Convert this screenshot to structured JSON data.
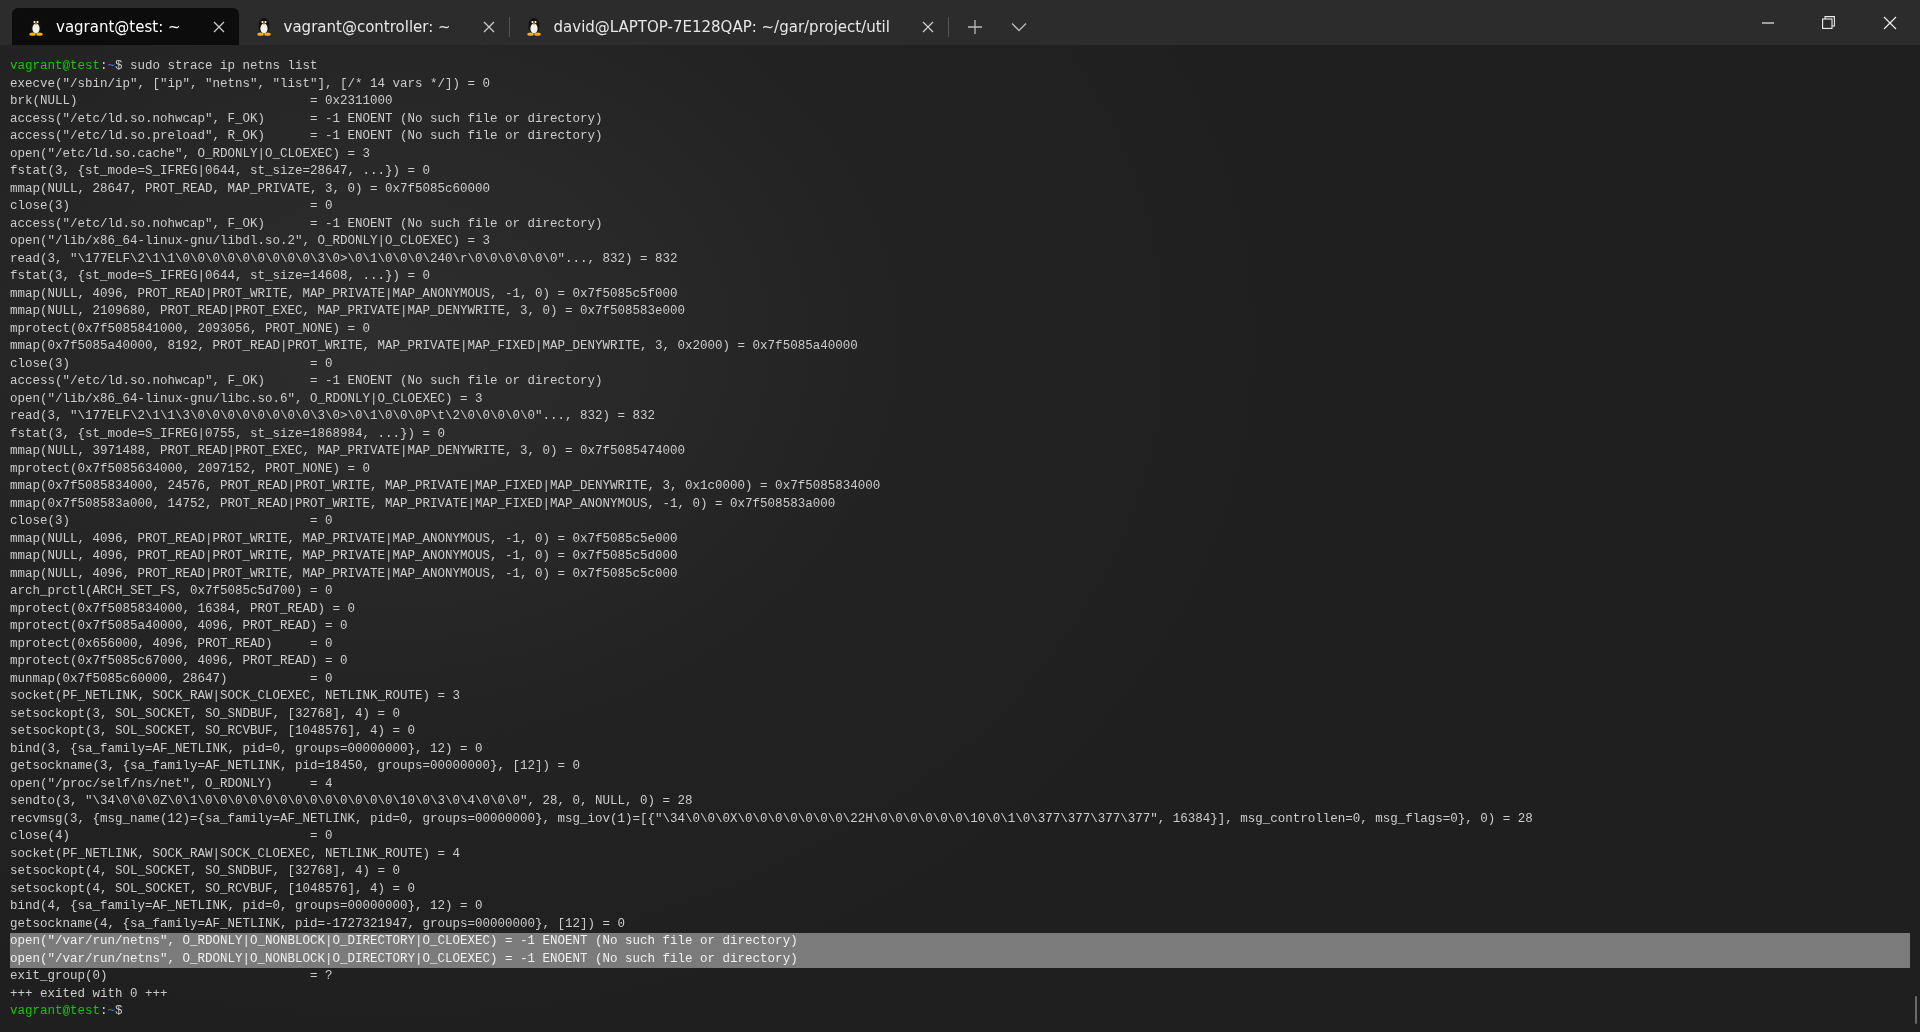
{
  "tabs": [
    {
      "title": "vagrant@test: ~",
      "selected": true
    },
    {
      "title": "vagrant@controller: ~",
      "selected": false
    },
    {
      "title": "david@LAPTOP-7E128QAP: ~/gar/project/util",
      "selected": false
    }
  ],
  "lines": [
    {
      "kind": "prompt",
      "user_host": "vagrant@test",
      "separator": ":",
      "path": "~",
      "symbol": "$",
      "command": " sudo strace ip netns list"
    },
    {
      "kind": "output",
      "text": "execve(\"/sbin/ip\", [\"ip\", \"netns\", \"list\"], [/* 14 vars */]) = 0",
      "selected": false
    },
    {
      "kind": "output",
      "text": "brk(NULL)                               = 0x2311000",
      "selected": false
    },
    {
      "kind": "output",
      "text": "access(\"/etc/ld.so.nohwcap\", F_OK)      = -1 ENOENT (No such file or directory)",
      "selected": false
    },
    {
      "kind": "output",
      "text": "access(\"/etc/ld.so.preload\", R_OK)      = -1 ENOENT (No such file or directory)",
      "selected": false
    },
    {
      "kind": "output",
      "text": "open(\"/etc/ld.so.cache\", O_RDONLY|O_CLOEXEC) = 3",
      "selected": false
    },
    {
      "kind": "output",
      "text": "fstat(3, {st_mode=S_IFREG|0644, st_size=28647, ...}) = 0",
      "selected": false
    },
    {
      "kind": "output",
      "text": "mmap(NULL, 28647, PROT_READ, MAP_PRIVATE, 3, 0) = 0x7f5085c60000",
      "selected": false
    },
    {
      "kind": "output",
      "text": "close(3)                                = 0",
      "selected": false
    },
    {
      "kind": "output",
      "text": "access(\"/etc/ld.so.nohwcap\", F_OK)      = -1 ENOENT (No such file or directory)",
      "selected": false
    },
    {
      "kind": "output",
      "text": "open(\"/lib/x86_64-linux-gnu/libdl.so.2\", O_RDONLY|O_CLOEXEC) = 3",
      "selected": false
    },
    {
      "kind": "output",
      "text": "read(3, \"\\177ELF\\2\\1\\1\\0\\0\\0\\0\\0\\0\\0\\0\\0\\3\\0>\\0\\1\\0\\0\\0\\240\\r\\0\\0\\0\\0\\0\\0\"..., 832) = 832",
      "selected": false
    },
    {
      "kind": "output",
      "text": "fstat(3, {st_mode=S_IFREG|0644, st_size=14608, ...}) = 0",
      "selected": false
    },
    {
      "kind": "output",
      "text": "mmap(NULL, 4096, PROT_READ|PROT_WRITE, MAP_PRIVATE|MAP_ANONYMOUS, -1, 0) = 0x7f5085c5f000",
      "selected": false
    },
    {
      "kind": "output",
      "text": "mmap(NULL, 2109680, PROT_READ|PROT_EXEC, MAP_PRIVATE|MAP_DENYWRITE, 3, 0) = 0x7f508583e000",
      "selected": false
    },
    {
      "kind": "output",
      "text": "mprotect(0x7f5085841000, 2093056, PROT_NONE) = 0",
      "selected": false
    },
    {
      "kind": "output",
      "text": "mmap(0x7f5085a40000, 8192, PROT_READ|PROT_WRITE, MAP_PRIVATE|MAP_FIXED|MAP_DENYWRITE, 3, 0x2000) = 0x7f5085a40000",
      "selected": false
    },
    {
      "kind": "output",
      "text": "close(3)                                = 0",
      "selected": false
    },
    {
      "kind": "output",
      "text": "access(\"/etc/ld.so.nohwcap\", F_OK)      = -1 ENOENT (No such file or directory)",
      "selected": false
    },
    {
      "kind": "output",
      "text": "open(\"/lib/x86_64-linux-gnu/libc.so.6\", O_RDONLY|O_CLOEXEC) = 3",
      "selected": false
    },
    {
      "kind": "output",
      "text": "read(3, \"\\177ELF\\2\\1\\1\\3\\0\\0\\0\\0\\0\\0\\0\\0\\3\\0>\\0\\1\\0\\0\\0P\\t\\2\\0\\0\\0\\0\\0\"..., 832) = 832",
      "selected": false
    },
    {
      "kind": "output",
      "text": "fstat(3, {st_mode=S_IFREG|0755, st_size=1868984, ...}) = 0",
      "selected": false
    },
    {
      "kind": "output",
      "text": "mmap(NULL, 3971488, PROT_READ|PROT_EXEC, MAP_PRIVATE|MAP_DENYWRITE, 3, 0) = 0x7f5085474000",
      "selected": false
    },
    {
      "kind": "output",
      "text": "mprotect(0x7f5085634000, 2097152, PROT_NONE) = 0",
      "selected": false
    },
    {
      "kind": "output",
      "text": "mmap(0x7f5085834000, 24576, PROT_READ|PROT_WRITE, MAP_PRIVATE|MAP_FIXED|MAP_DENYWRITE, 3, 0x1c0000) = 0x7f5085834000",
      "selected": false
    },
    {
      "kind": "output",
      "text": "mmap(0x7f508583a000, 14752, PROT_READ|PROT_WRITE, MAP_PRIVATE|MAP_FIXED|MAP_ANONYMOUS, -1, 0) = 0x7f508583a000",
      "selected": false
    },
    {
      "kind": "output",
      "text": "close(3)                                = 0",
      "selected": false
    },
    {
      "kind": "output",
      "text": "mmap(NULL, 4096, PROT_READ|PROT_WRITE, MAP_PRIVATE|MAP_ANONYMOUS, -1, 0) = 0x7f5085c5e000",
      "selected": false
    },
    {
      "kind": "output",
      "text": "mmap(NULL, 4096, PROT_READ|PROT_WRITE, MAP_PRIVATE|MAP_ANONYMOUS, -1, 0) = 0x7f5085c5d000",
      "selected": false
    },
    {
      "kind": "output",
      "text": "mmap(NULL, 4096, PROT_READ|PROT_WRITE, MAP_PRIVATE|MAP_ANONYMOUS, -1, 0) = 0x7f5085c5c000",
      "selected": false
    },
    {
      "kind": "output",
      "text": "arch_prctl(ARCH_SET_FS, 0x7f5085c5d700) = 0",
      "selected": false
    },
    {
      "kind": "output",
      "text": "mprotect(0x7f5085834000, 16384, PROT_READ) = 0",
      "selected": false
    },
    {
      "kind": "output",
      "text": "mprotect(0x7f5085a40000, 4096, PROT_READ) = 0",
      "selected": false
    },
    {
      "kind": "output",
      "text": "mprotect(0x656000, 4096, PROT_READ)     = 0",
      "selected": false
    },
    {
      "kind": "output",
      "text": "mprotect(0x7f5085c67000, 4096, PROT_READ) = 0",
      "selected": false
    },
    {
      "kind": "output",
      "text": "munmap(0x7f5085c60000, 28647)           = 0",
      "selected": false
    },
    {
      "kind": "output",
      "text": "socket(PF_NETLINK, SOCK_RAW|SOCK_CLOEXEC, NETLINK_ROUTE) = 3",
      "selected": false
    },
    {
      "kind": "output",
      "text": "setsockopt(3, SOL_SOCKET, SO_SNDBUF, [32768], 4) = 0",
      "selected": false
    },
    {
      "kind": "output",
      "text": "setsockopt(3, SOL_SOCKET, SO_RCVBUF, [1048576], 4) = 0",
      "selected": false
    },
    {
      "kind": "output",
      "text": "bind(3, {sa_family=AF_NETLINK, pid=0, groups=00000000}, 12) = 0",
      "selected": false
    },
    {
      "kind": "output",
      "text": "getsockname(3, {sa_family=AF_NETLINK, pid=18450, groups=00000000}, [12]) = 0",
      "selected": false
    },
    {
      "kind": "output",
      "text": "open(\"/proc/self/ns/net\", O_RDONLY)     = 4",
      "selected": false
    },
    {
      "kind": "output",
      "text": "sendto(3, \"\\34\\0\\0\\0Z\\0\\1\\0\\0\\0\\0\\0\\0\\0\\0\\0\\0\\0\\0\\0\\10\\0\\3\\0\\4\\0\\0\\0\", 28, 0, NULL, 0) = 28",
      "selected": false
    },
    {
      "kind": "output",
      "text": "recvmsg(3, {msg_name(12)={sa_family=AF_NETLINK, pid=0, groups=00000000}, msg_iov(1)=[{\"\\34\\0\\0\\0X\\0\\0\\0\\0\\0\\0\\0\\22H\\0\\0\\0\\0\\0\\0\\10\\0\\1\\0\\377\\377\\377\\377\", 16384}], msg_controllen=0, msg_flags=0}, 0) = 28",
      "selected": false
    },
    {
      "kind": "output",
      "text": "close(4)                                = 0",
      "selected": false
    },
    {
      "kind": "output",
      "text": "socket(PF_NETLINK, SOCK_RAW|SOCK_CLOEXEC, NETLINK_ROUTE) = 4",
      "selected": false
    },
    {
      "kind": "output",
      "text": "setsockopt(4, SOL_SOCKET, SO_SNDBUF, [32768], 4) = 0",
      "selected": false
    },
    {
      "kind": "output",
      "text": "setsockopt(4, SOL_SOCKET, SO_RCVBUF, [1048576], 4) = 0",
      "selected": false
    },
    {
      "kind": "output",
      "text": "bind(4, {sa_family=AF_NETLINK, pid=0, groups=00000000}, 12) = 0",
      "selected": false
    },
    {
      "kind": "output",
      "text": "getsockname(4, {sa_family=AF_NETLINK, pid=-1727321947, groups=00000000}, [12]) = 0",
      "selected": false
    },
    {
      "kind": "output",
      "text": "open(\"/var/run/netns\", O_RDONLY|O_NONBLOCK|O_DIRECTORY|O_CLOEXEC) = -1 ENOENT (No such file or directory)",
      "selected": true
    },
    {
      "kind": "output",
      "text": "open(\"/var/run/netns\", O_RDONLY|O_NONBLOCK|O_DIRECTORY|O_CLOEXEC) = -1 ENOENT (No such file or directory)",
      "selected": true
    },
    {
      "kind": "output",
      "text": "exit_group(0)                           = ?",
      "selected": false
    },
    {
      "kind": "output",
      "text": "+++ exited with 0 +++",
      "selected": false
    },
    {
      "kind": "prompt",
      "user_host": "vagrant@test",
      "separator": ":",
      "path": "~",
      "symbol": "$"
    }
  ]
}
